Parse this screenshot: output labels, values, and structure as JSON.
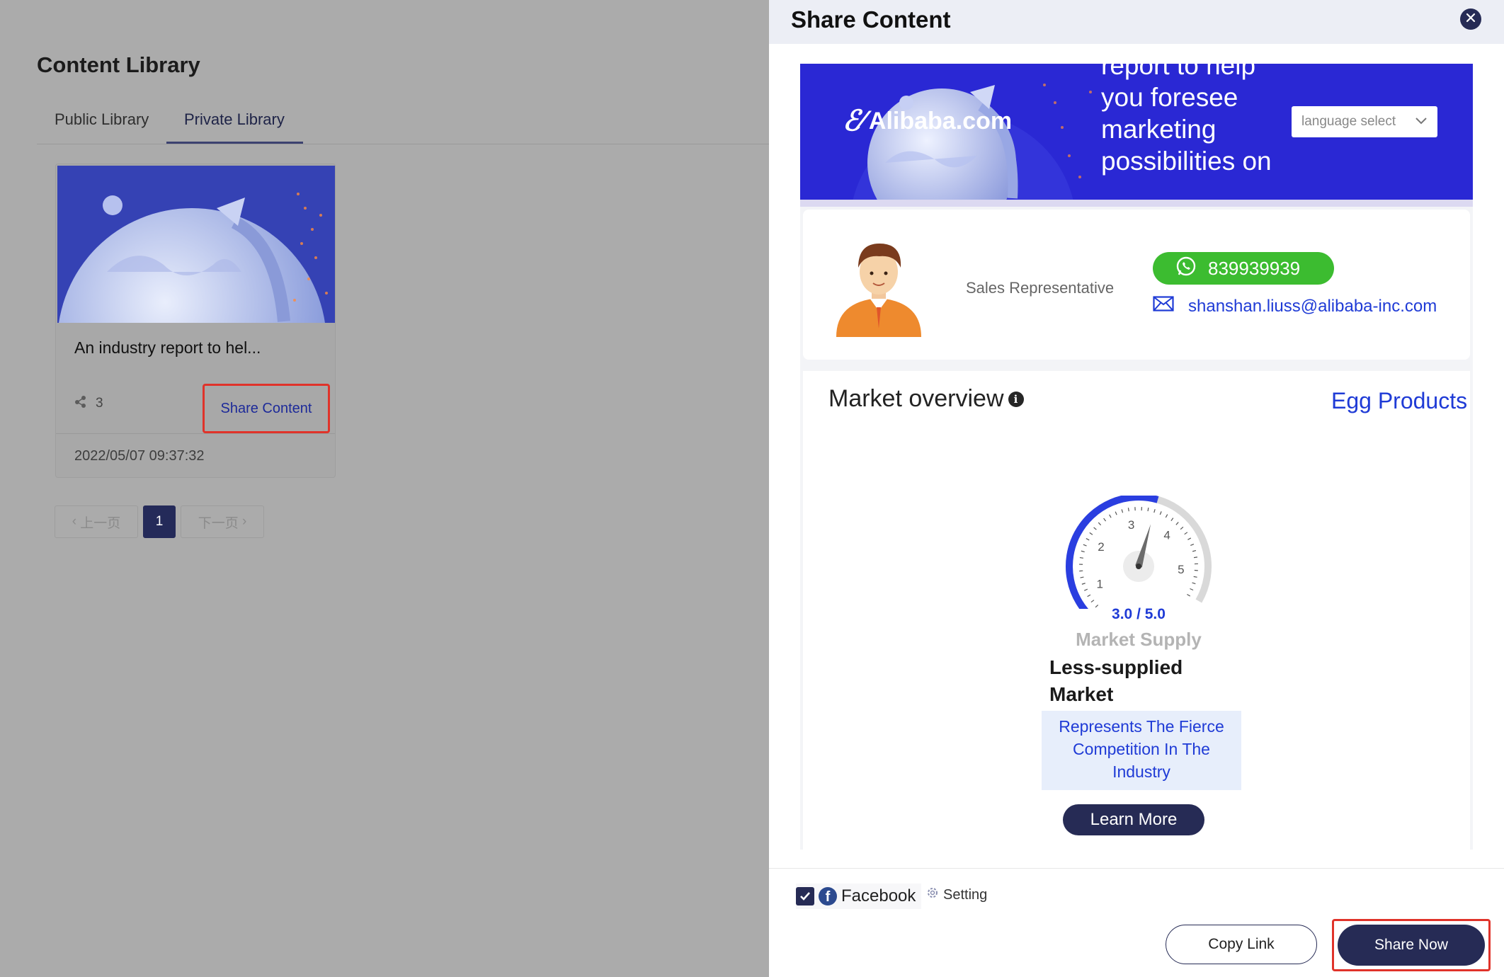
{
  "library": {
    "title": "Content Library",
    "tabs": [
      {
        "label": "Public Library",
        "active": false
      },
      {
        "label": "Private Library",
        "active": true
      }
    ],
    "card": {
      "title": "An industry report to hel...",
      "share_count": "3",
      "share_button": "Share Content",
      "date": "2022/05/07 09:37:32"
    },
    "pagination": {
      "prev": "上一页",
      "current": "1",
      "next": "下一页"
    }
  },
  "drawer": {
    "title": "Share Content",
    "banner": {
      "logo_text": "Alibaba.com",
      "headline": "report to help you foresee marketing possibilities on",
      "language_select": "language select"
    },
    "contact": {
      "role": "Sales Representative",
      "whatsapp": "839939939",
      "email": "shanshan.liuss@alibaba-inc.com"
    },
    "market": {
      "title": "Market overview",
      "category": "Egg Products",
      "gauge_value": 3.0,
      "gauge_max": 5.0,
      "gauge_text": "3.0 / 5.0",
      "gauge_ticks": [
        "1",
        "2",
        "3",
        "4",
        "5"
      ],
      "caption": "Market Supply",
      "level": "Less-supplied Market",
      "description": "Represents The Fierce Competition In The Industry",
      "learn_more": "Learn More"
    },
    "footer": {
      "facebook_label": "Facebook",
      "facebook_checked": true,
      "setting_label": "Setting",
      "copy_link": "Copy Link",
      "share_now": "Share Now"
    }
  },
  "colors": {
    "navy": "#262b55",
    "accent_blue": "#1f3bd6",
    "whatsapp_green": "#3cbc30",
    "highlight_red": "#e0332a",
    "banner_blue": "#2a28d4"
  }
}
